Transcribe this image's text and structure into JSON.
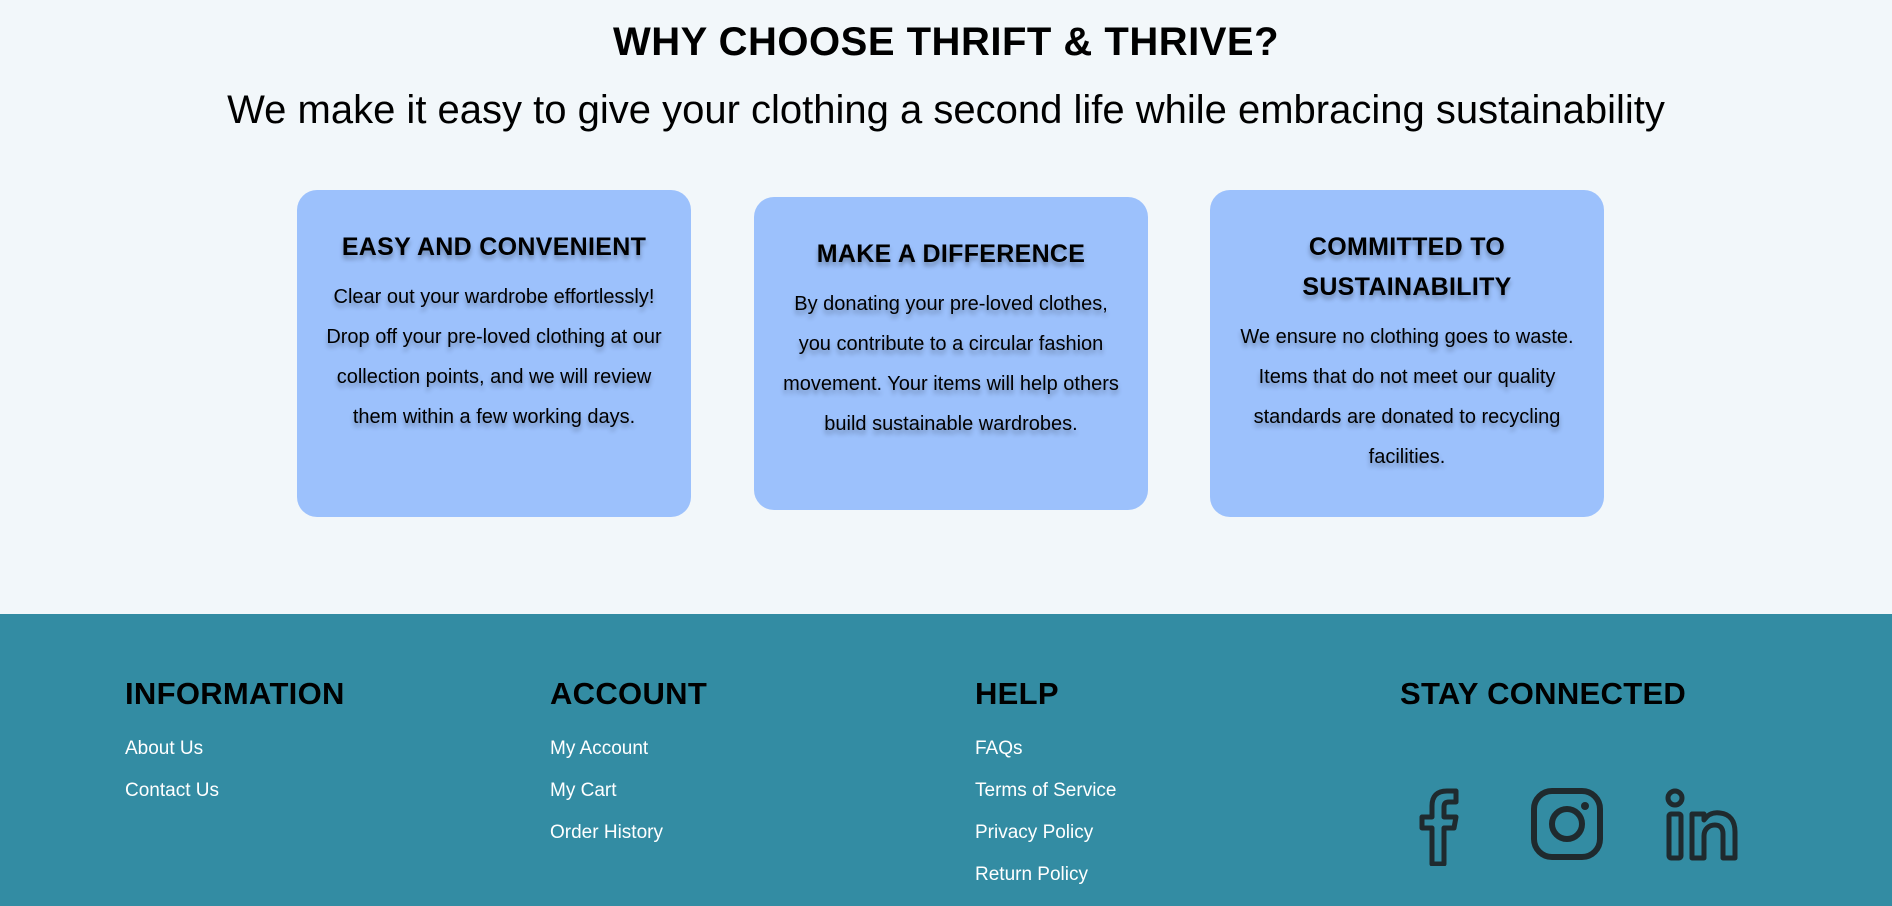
{
  "why": {
    "title": "WHY CHOOSE THRIFT & THRIVE?",
    "subtitle": "We make it easy to give your clothing a second life while embracing sustainability",
    "cards": [
      {
        "title": "EASY AND CONVENIENT",
        "text": "Clear out your wardrobe effortlessly! Drop off your pre-loved clothing at our collection points, and we will review them within a few working days."
      },
      {
        "title": "MAKE A DIFFERENCE",
        "text": "By donating your pre-loved clothes, you contribute to a circular fashion movement. Your items will help others build sustainable wardrobes."
      },
      {
        "title": "COMMITTED TO SUSTAINABILITY",
        "text": "We ensure no clothing goes to waste. Items that do not meet our quality standards are donated to recycling facilities."
      }
    ]
  },
  "footer": {
    "information": {
      "heading": "INFORMATION",
      "links": [
        "About Us",
        "Contact Us"
      ]
    },
    "account": {
      "heading": "ACCOUNT",
      "links": [
        "My Account",
        "My Cart",
        "Order History"
      ]
    },
    "help": {
      "heading": "HELP",
      "links": [
        "FAQs",
        "Terms of Service",
        "Privacy Policy",
        "Return Policy"
      ]
    },
    "social": {
      "heading": "STAY CONNECTED",
      "icons": [
        "facebook-icon",
        "instagram-icon",
        "linkedin-icon"
      ]
    }
  },
  "colors": {
    "page_bg": "#f2f7fa",
    "card_bg": "#9cc1fc",
    "footer_bg": "#338ca3",
    "icon_color": "#1f2a2e"
  }
}
